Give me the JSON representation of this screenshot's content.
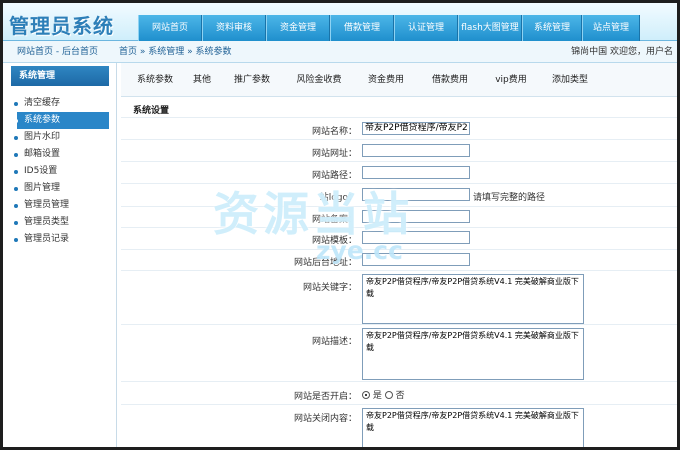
{
  "header": {
    "logo_text": "管理员系统",
    "nav": [
      "网站首页",
      "资料审核",
      "资金管理",
      "借款管理",
      "认证管理",
      "flash大图管理",
      "系统管理",
      "站点管理"
    ]
  },
  "bar": {
    "home_links": "网站首页 - 后台首页",
    "breadcrumb": "首页 » 系统管理 » 系统参数",
    "welcome": "锦尚中国 欢迎您，用户名"
  },
  "sidebar": {
    "title": "系统管理",
    "items": [
      "清空缓存",
      "系统参数",
      "图片水印",
      "邮箱设置",
      "ID5设置",
      "图片管理",
      "管理员管理",
      "管理员类型",
      "管理员记录"
    ],
    "active_index": 1
  },
  "tabs": [
    "系统参数",
    "其他",
    "推广参数",
    "风险金收费",
    "资金费用",
    "借款费用",
    "vip费用",
    "添加类型"
  ],
  "section_title": "系统设置",
  "form": {
    "site_name_label": "网站名称：",
    "site_name_value": "帝友P2P借贷程序/帝友P2",
    "site_url_label": "网站网址：",
    "site_url_value": "",
    "site_path_label": "网站路径：",
    "site_path_value": "",
    "logo_label": "站logo：",
    "logo_value": "",
    "logo_hint": "请填写完整的路径",
    "icp_label": "网站备案：",
    "icp_value": "",
    "template_label": "网站模板：",
    "template_value": "",
    "admin_url_label": "网站后台地址：",
    "admin_url_value": "",
    "keywords_label": "网站关键字：",
    "keywords_value": "帝友P2P借贷程序/帝友P2P借贷系统V4.1 完美破解商业版下载",
    "desc_label": "网站描述：",
    "desc_value": "帝友P2P借贷程序/帝友P2P借贷系统V4.1 完美破解商业版下载",
    "open_label": "网站是否开启：",
    "open_yes": "是",
    "open_no": "否",
    "close_content_label": "网站关闭内容：",
    "close_content_value": "帝友P2P借贷程序/帝友P2P借贷系统V4.1 完美破解商业版下载"
  },
  "watermark": {
    "text": "资源当站",
    "domain": "zye.cc"
  }
}
